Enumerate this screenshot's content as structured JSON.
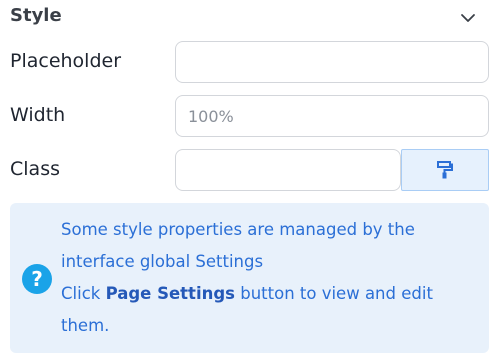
{
  "section": {
    "title": "Style"
  },
  "fields": {
    "placeholder": {
      "label": "Placeholder",
      "value": "",
      "placeholder": ""
    },
    "width": {
      "label": "Width",
      "value": "",
      "placeholder": "100%"
    },
    "class": {
      "label": "Class",
      "value": "",
      "placeholder": ""
    }
  },
  "class_button": {
    "icon": "paint-roller-icon"
  },
  "info": {
    "icon": "question-icon",
    "icon_glyph": "?",
    "line1": "Some style properties are managed by the interface global Settings",
    "line2_prefix": "Click ",
    "line2_bold": "Page Settings",
    "line2_suffix": " button to view and edit them."
  },
  "colors": {
    "accent": "#2b6fd6",
    "info_bg": "#e8f1fb",
    "icon_blue": "#1aa3e8"
  }
}
